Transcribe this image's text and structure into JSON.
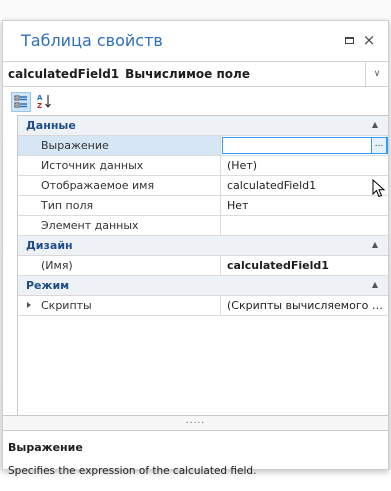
{
  "window": {
    "title": "Таблица свойств",
    "maximize_icon": "maximize-icon",
    "close_glyph": "×"
  },
  "object_selector": {
    "name": "calculatedField1",
    "type": "Вычислимое поле",
    "dropdown_glyph": "∨"
  },
  "toolbar": {
    "categorized_icon": "categorized-view-icon",
    "alphabetical_icon": "alphabetical-sort-icon",
    "categorized_selected": true
  },
  "grid": {
    "categories": [
      {
        "label": "Данные",
        "collapse_glyph": "▲",
        "properties": [
          {
            "name": "Выражение",
            "value": "",
            "selected": true,
            "has_ellipsis": true
          },
          {
            "name": "Источник данных",
            "value": "(Нет)"
          },
          {
            "name": "Отображаемое имя",
            "value": "calculatedField1"
          },
          {
            "name": "Тип поля",
            "value": "Нет"
          },
          {
            "name": "Элемент данных",
            "value": ""
          }
        ]
      },
      {
        "label": "Дизайн",
        "collapse_glyph": "▲",
        "properties": [
          {
            "name": "(Имя)",
            "value": "calculatedField1",
            "bold": true
          }
        ]
      },
      {
        "label": "Режим",
        "collapse_glyph": "▲",
        "properties": [
          {
            "name": "Скрипты",
            "value": "(Скрипты вычисляемого п...",
            "expandable": true
          }
        ]
      }
    ],
    "ellipsis_glyph": "..."
  },
  "splitter": {
    "grip": "....."
  },
  "description": {
    "title": "Выражение",
    "text": "Specifies the expression of the calculated field."
  },
  "colors": {
    "title": "#2e6fbd",
    "category_text": "#1f4e8a",
    "category_bg": "#eef2f7",
    "selection_bg": "#d6e6f5",
    "editor_border": "#3399ff"
  }
}
